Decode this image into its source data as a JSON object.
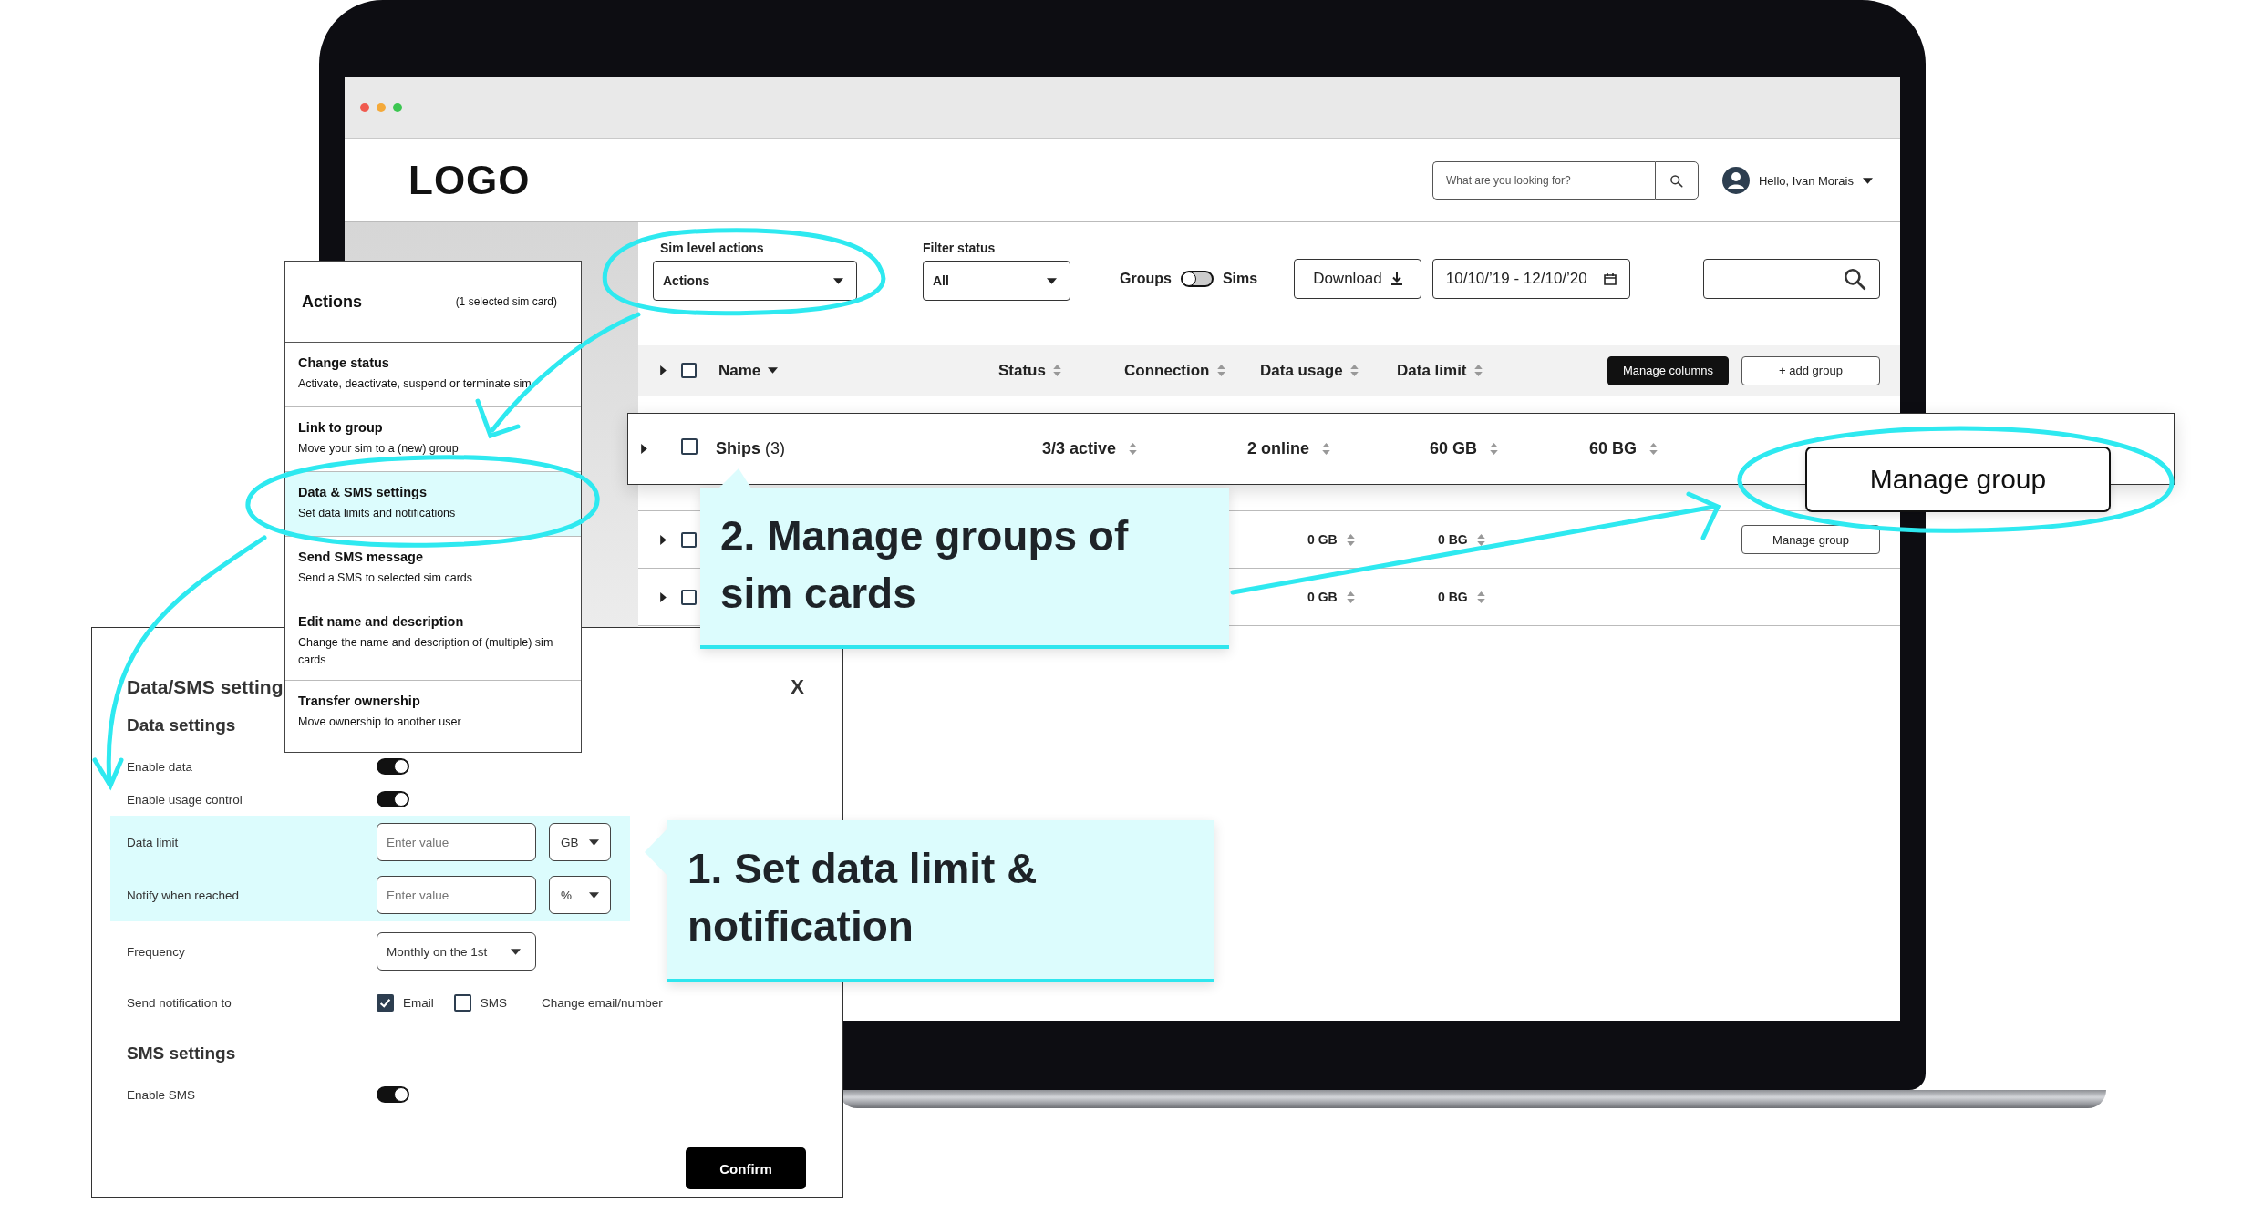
{
  "browser": {
    "logo": "LOGO",
    "search": {
      "placeholder": "What are you looking for?"
    },
    "user": {
      "greeting": "Hello, Ivan Morais"
    }
  },
  "toolbar": {
    "sim_actions": {
      "label": "Sim level actions",
      "value": "Actions"
    },
    "filter_status": {
      "label": "Filter status",
      "value": "All"
    },
    "view_toggle": {
      "left": "Groups",
      "right": "Sims",
      "on": false
    },
    "download": "Download",
    "date_range": "10/10/’19 - 12/10/’20"
  },
  "table": {
    "select_all_checked": false,
    "columns": [
      "Name",
      "Status",
      "Connection",
      "Data usage",
      "Data limit"
    ],
    "buttons": [
      "Manage columns",
      "+ add group"
    ],
    "rows": [
      {
        "data_usage": "0 GB",
        "data_limit": "0 BG",
        "action": "Manage group",
        "checked": false
      },
      {
        "data_usage": "0 GB",
        "data_limit": "0 BG",
        "checked": false
      }
    ]
  },
  "highlighted_row": {
    "name": "Ships",
    "count": "(3)",
    "status": "3/3 active",
    "connection": "2 online",
    "data_usage": "60 GB",
    "data_limit": "60 BG",
    "checked": false
  },
  "manage_group_popup": {
    "label": "Manage group"
  },
  "actions_menu": {
    "title": "Actions",
    "subtitle": "(1 selected sim card)",
    "items": [
      {
        "title": "Change status",
        "description": "Activate, deactivate, suspend or terminate sim",
        "selected": false
      },
      {
        "title": "Link to group",
        "description": "Move your sim to a (new) group",
        "selected": false
      },
      {
        "title": "Data & SMS settings",
        "description": "Set data limits and notifications",
        "selected": true
      },
      {
        "title": "Send SMS message",
        "description": "Send a SMS to selected sim cards",
        "selected": false
      },
      {
        "title": "Edit name and description",
        "description": "Change the name and description of (multiple) sim cards",
        "selected": false
      },
      {
        "title": "Transfer ownership",
        "description": "Move ownership to another user",
        "selected": false
      }
    ]
  },
  "dialog": {
    "title": "Data/SMS setting",
    "close": "X",
    "sections": [
      {
        "heading": "Data settings",
        "rows": [
          {
            "kind": "toggle",
            "label": "Enable data",
            "on": true,
            "highlighted": false
          },
          {
            "kind": "toggle",
            "label": "Enable usage control",
            "on": true,
            "highlighted": false
          },
          {
            "kind": "input",
            "label": "Data limit",
            "placeholder": "Enter value",
            "unit": "GB",
            "highlighted": true
          },
          {
            "kind": "input",
            "label": "Notify when reached",
            "placeholder": "Enter value",
            "unit": "%",
            "highlighted": true
          },
          {
            "kind": "select",
            "label": "Frequency",
            "value": "Monthly on the 1st",
            "highlighted": false
          },
          {
            "kind": "channels",
            "label": "Send notification to",
            "options": [
              {
                "label": "Email",
                "checked": true
              },
              {
                "label": "SMS",
                "checked": false
              }
            ],
            "link": "Change email/number",
            "highlighted": false
          }
        ]
      },
      {
        "heading": "SMS settings",
        "rows": [
          {
            "kind": "toggle",
            "label": "Enable SMS",
            "on": true,
            "highlighted": false
          }
        ]
      }
    ],
    "confirm": "Confirm"
  },
  "callouts": [
    {
      "text": "2. Manage groups of sim cards"
    },
    {
      "text": "1. Set data limit & notification"
    }
  ]
}
